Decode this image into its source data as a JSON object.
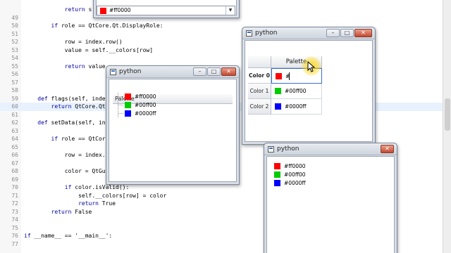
{
  "editor": {
    "highlighted_line": 60,
    "lines": [
      {
        "no": "",
        "code": "            return s"
      },
      {
        "no": "49",
        "code": ""
      },
      {
        "no": "50",
        "code": "        if role == QtCore.Qt.DisplayRole:"
      },
      {
        "no": "51",
        "code": ""
      },
      {
        "no": "52",
        "code": "            row = index.row()"
      },
      {
        "no": "53",
        "code": "            value = self.__colors[row]"
      },
      {
        "no": "54",
        "code": ""
      },
      {
        "no": "55",
        "code": "            return value"
      },
      {
        "no": "56",
        "code": ""
      },
      {
        "no": "57",
        "code": ""
      },
      {
        "no": "58",
        "code": ""
      },
      {
        "no": "59",
        "code": "    def flags(self, inde"
      },
      {
        "no": "60",
        "code": "        return QtCore.Qt"
      },
      {
        "no": "61",
        "code": ""
      },
      {
        "no": "62",
        "code": "    def setData(self, in"
      },
      {
        "no": "63",
        "code": ""
      },
      {
        "no": "64",
        "code": "        if role == QtCor"
      },
      {
        "no": "65",
        "code": ""
      },
      {
        "no": "66",
        "code": "            row = index."
      },
      {
        "no": "67",
        "code": ""
      },
      {
        "no": "68",
        "code": "            color = QtGu"
      },
      {
        "no": "69",
        "code": ""
      },
      {
        "no": "70",
        "code": "            if color.isValid():"
      },
      {
        "no": "71",
        "code": "                self.__colors[row] = color"
      },
      {
        "no": "72",
        "code": "                return True"
      },
      {
        "no": "73",
        "code": "        return False"
      },
      {
        "no": "74",
        "code": ""
      },
      {
        "no": "75",
        "code": ""
      },
      {
        "no": "76",
        "code": "if __name__ == '__main__':"
      },
      {
        "no": "77",
        "code": ""
      }
    ]
  },
  "combo_window": {
    "combo_value": "#ff0000",
    "combo_color": "#ff0000"
  },
  "list_window": {
    "title": "python",
    "header": "Palette",
    "items": [
      {
        "label": "#ff0000",
        "color": "#ff0000"
      },
      {
        "label": "#00ff00",
        "color": "#00cc00"
      },
      {
        "label": "#0000ff",
        "color": "#0000ff"
      }
    ]
  },
  "table_window": {
    "title": "python",
    "column_header": "Palette",
    "rows": [
      {
        "header": "Color 0",
        "value": "#",
        "color": "#ff0000",
        "editing": true
      },
      {
        "header": "Color 1",
        "value": "#00ff00",
        "color": "#00cc00",
        "editing": false
      },
      {
        "header": "Color 2",
        "value": "#0000ff",
        "color": "#0000ff",
        "editing": false
      }
    ]
  },
  "bottom_window": {
    "title": "python",
    "items": [
      {
        "label": "#ff0000",
        "color": "#ff0000"
      },
      {
        "label": "#00ff00",
        "color": "#00cc00"
      },
      {
        "label": "#0000ff",
        "color": "#0000ff"
      }
    ]
  },
  "window_buttons": {
    "minimize": "–",
    "maximize": "□",
    "close": "✕"
  },
  "colors": {
    "editor_highlight": "#e8f2fe",
    "keyword": "#0000a0",
    "cursor_glow": "#ffd600"
  }
}
